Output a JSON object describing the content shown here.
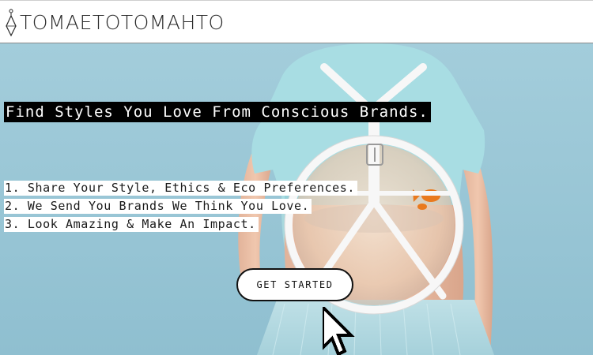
{
  "header": {
    "logo_text": "TOMAETOTOMAHTO",
    "logo_icon": "diamond-pendant-icon"
  },
  "hero": {
    "image": "person-wearing-fishbowl-backpack",
    "headline": "Find Styles You Love From Conscious Brands.",
    "steps": [
      "1. Share Your Style, Ethics & Eco Preferences.",
      "2. We Send You Brands We Think You Love.",
      "3. Look Amazing & Make An Impact."
    ],
    "cta_label": "GET STARTED",
    "cursor_icon": "pixel-pointer-cursor-icon"
  },
  "colors": {
    "hero_background": "#9cc8d7",
    "headline_bg": "#000000",
    "headline_text": "#ffffff",
    "step_bg": "#ffffff",
    "button_border": "#111111"
  }
}
